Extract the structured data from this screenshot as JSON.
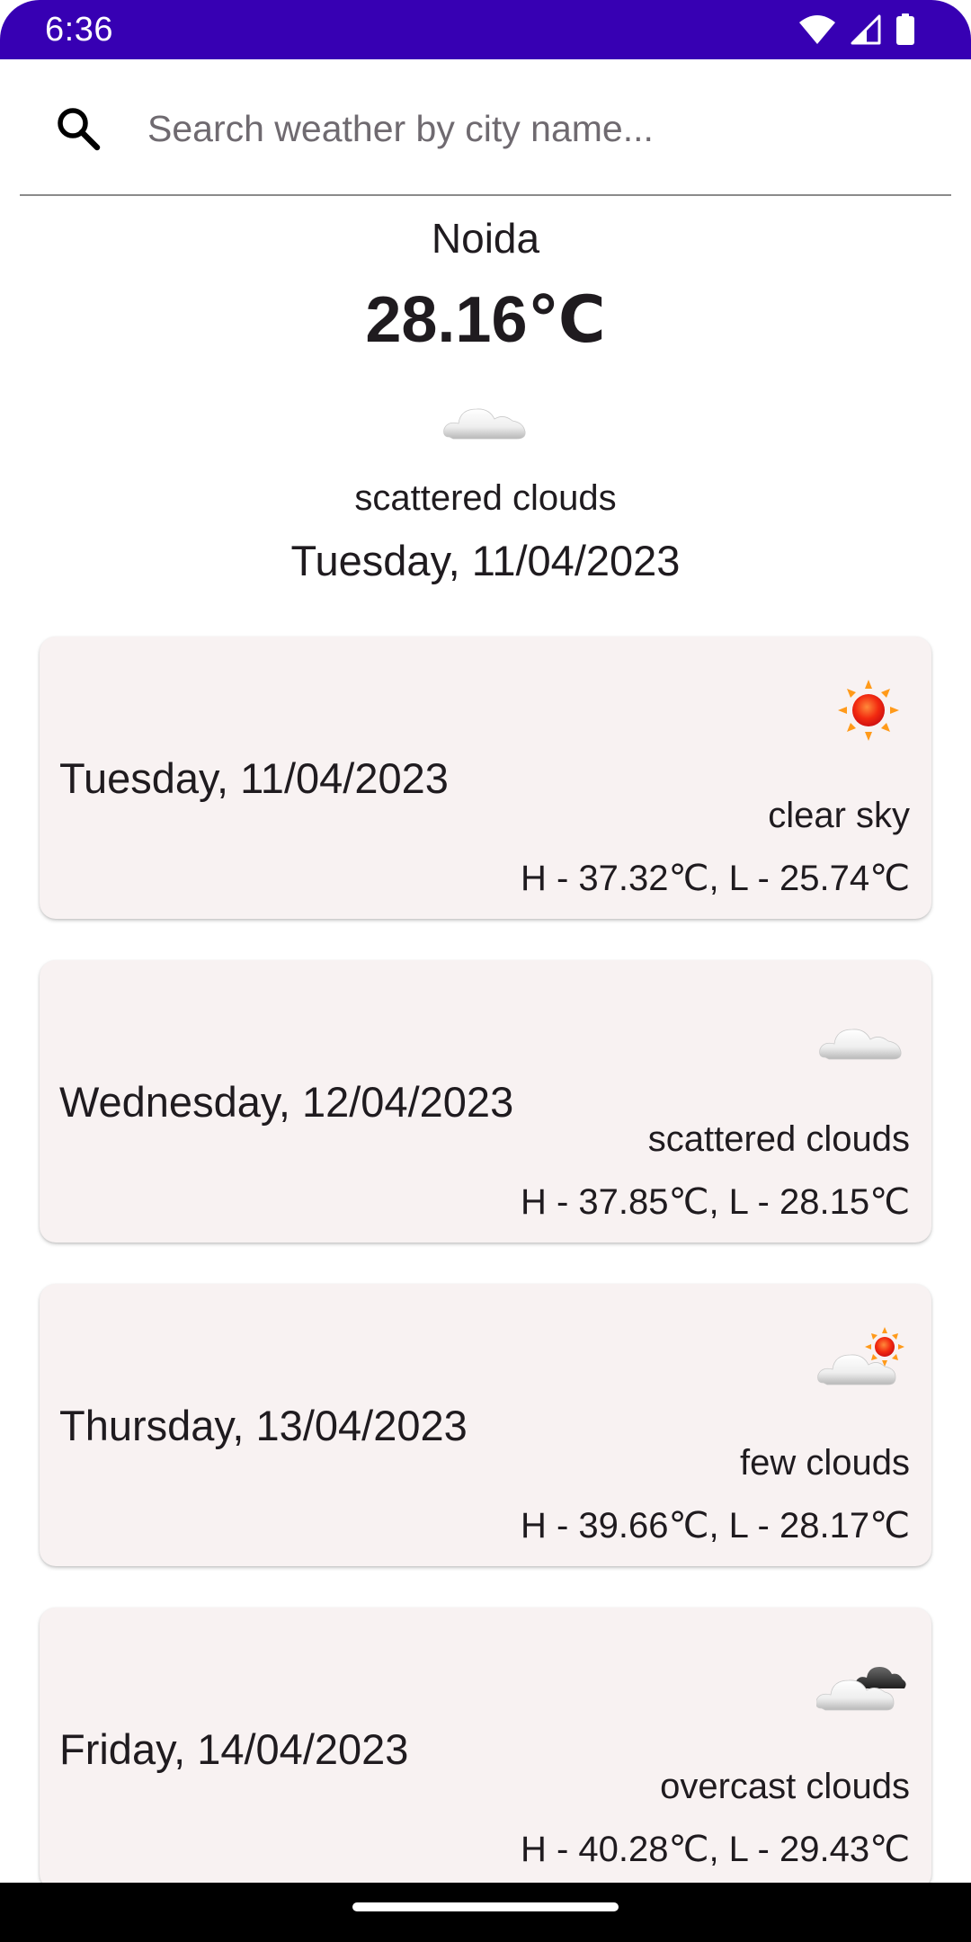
{
  "status_bar": {
    "time": "6:36",
    "icons": [
      "wifi-icon",
      "signal-icon",
      "battery-icon"
    ],
    "color": "#3700b3"
  },
  "search": {
    "placeholder": "Search weather by city name...",
    "value": ""
  },
  "current": {
    "city": "Noida",
    "temperature": "28.16℃",
    "icon": "scattered-clouds-icon",
    "description": "scattered clouds",
    "date": "Tuesday, 11/04/2023"
  },
  "forecast": [
    {
      "date": "Tuesday, 11/04/2023",
      "icon": "clear-sky-icon",
      "description": "clear sky",
      "range": "H - 37.32℃, L - 25.74℃"
    },
    {
      "date": "Wednesday, 12/04/2023",
      "icon": "scattered-clouds-icon",
      "description": "scattered clouds",
      "range": "H - 37.85℃, L - 28.15℃"
    },
    {
      "date": "Thursday, 13/04/2023",
      "icon": "few-clouds-icon",
      "description": "few clouds",
      "range": "H - 39.66℃, L - 28.17℃"
    },
    {
      "date": "Friday, 14/04/2023",
      "icon": "overcast-clouds-icon",
      "description": "overcast clouds",
      "range": "H - 40.28℃, L - 29.43℃"
    }
  ],
  "colors": {
    "card_background": "#f8f2f2",
    "text": "#1f1b1f",
    "placeholder": "#6f6a70"
  }
}
